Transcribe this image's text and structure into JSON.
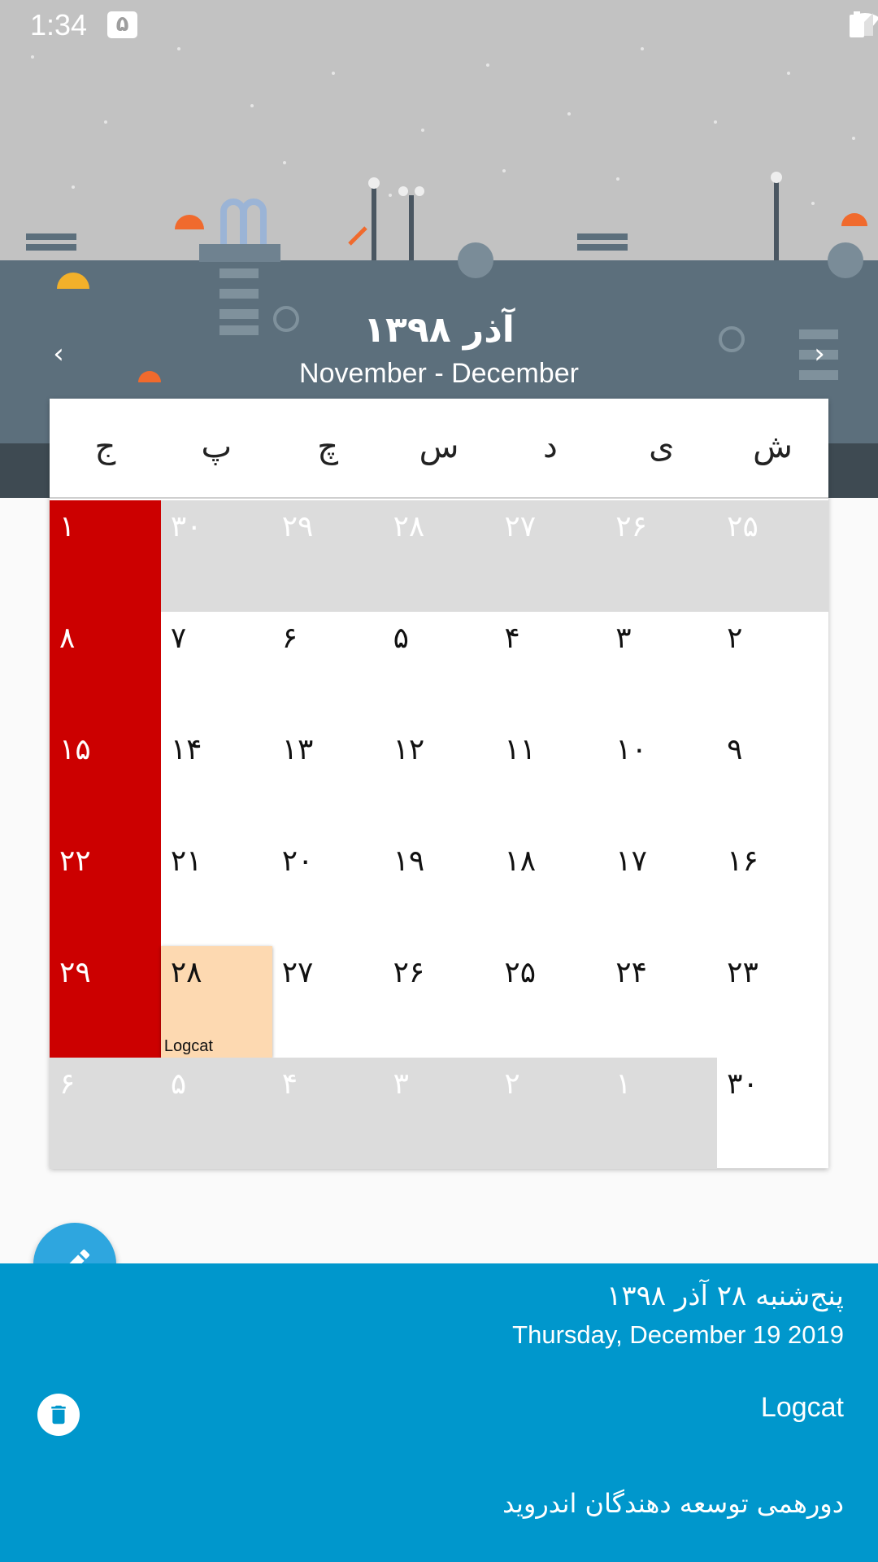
{
  "status": {
    "time": "1:34",
    "badge": "۵"
  },
  "header": {
    "month_title": "آذر ۱۳۹۸",
    "month_sub": "November - December",
    "prev_glyph": "‹",
    "next_glyph": "›"
  },
  "weekdays": [
    "ج",
    "پ",
    "چ",
    "س",
    "د",
    "ی",
    "ش"
  ],
  "calendar": {
    "rows": [
      [
        "۱",
        "۳۰",
        "۲۹",
        "۲۸",
        "۲۷",
        "۲۶",
        "۲۵"
      ],
      [
        "۸",
        "۷",
        "۶",
        "۵",
        "۴",
        "۳",
        "۲"
      ],
      [
        "۱۵",
        "۱۴",
        "۱۳",
        "۱۲",
        "۱۱",
        "۱۰",
        "۹"
      ],
      [
        "۲۲",
        "۲۱",
        "۲۰",
        "۱۹",
        "۱۸",
        "۱۷",
        "۱۶"
      ],
      [
        "۲۹",
        "۲۸",
        "۲۷",
        "۲۶",
        "۲۵",
        "۲۴",
        "۲۳"
      ],
      [
        "۶",
        "۵",
        "۴",
        "۳",
        "۲",
        "۱",
        "۳۰"
      ]
    ],
    "today_event": "Logcat"
  },
  "panel": {
    "persian_date": "پنج‌شنبه ۲۸ آذر ۱۳۹۸",
    "gregorian_date": "Thursday, December 19 2019",
    "event_title": "Logcat",
    "event_desc": "دورهمی توسعه دهندگان اندروید"
  },
  "colors": {
    "friday": "#cc0000",
    "other_month": "#dcdcdc",
    "today": "#fdd9b1",
    "panel": "#0097cc",
    "fab": "#2ea6df"
  },
  "icons": {
    "fab": "pencil-icon",
    "delete": "trash-icon"
  }
}
